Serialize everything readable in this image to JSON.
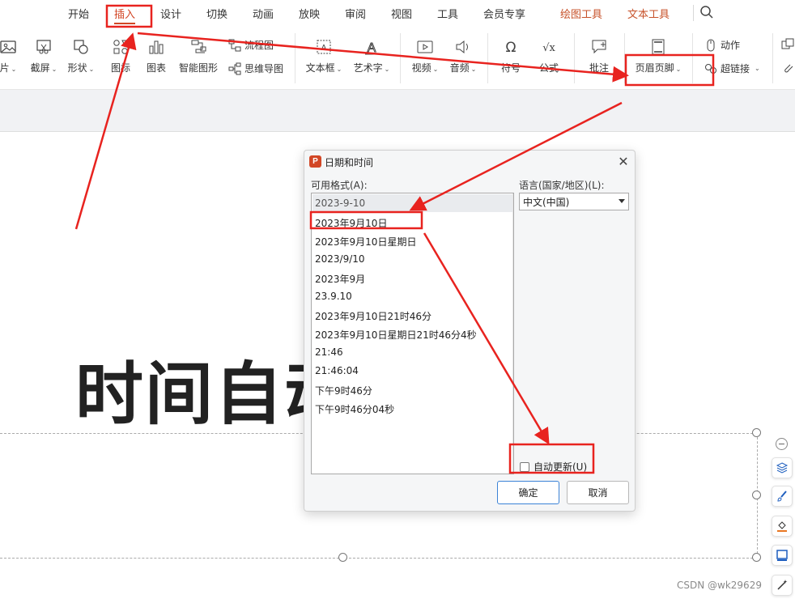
{
  "tabs": {
    "items": [
      "开始",
      "插入",
      "设计",
      "切换",
      "动画",
      "放映",
      "审阅",
      "视图",
      "工具",
      "会员专享",
      "绘图工具",
      "文本工具"
    ]
  },
  "ribbon": {
    "picture_partial": "片",
    "screenshot": "截屏",
    "shape": "形状",
    "icon_partial": "图标",
    "chart": "图表",
    "smartart": "智能图形",
    "flowchart": "流程图",
    "mindmap": "思维导图",
    "textbox": "文本框",
    "wordart": "艺术字",
    "video": "视频",
    "audio": "音频",
    "symbol_partial": "符号",
    "formula_partial": "公式",
    "comment": "批注",
    "header_footer": "页眉页脚",
    "action": "动作",
    "hyperlink": "超链接"
  },
  "slide": {
    "title_partial": "时间自动"
  },
  "dialog": {
    "title": "日期和时间",
    "formats_label": "可用格式(A):",
    "language_label": "语言(国家/地区)(L):",
    "formats": [
      "2023-9-10",
      "2023年9月10日",
      "2023年9月10日星期日",
      "2023/9/10",
      "2023年9月",
      "23.9.10",
      "2023年9月10日21时46分",
      "2023年9月10日星期日21时46分4秒",
      "21:46",
      "21:46:04",
      "下午9时46分",
      "下午9时46分04秒"
    ],
    "language_value": "中文(中国)",
    "auto_update_label": "自动更新(U)",
    "auto_update_checked": false,
    "ok_label": "确定",
    "cancel_label": "取消"
  },
  "watermark": "CSDN @wk29629",
  "colors": {
    "accent_red": "#d24726",
    "annotation_red": "#e8231f",
    "orange_tab": "#c7522a"
  }
}
